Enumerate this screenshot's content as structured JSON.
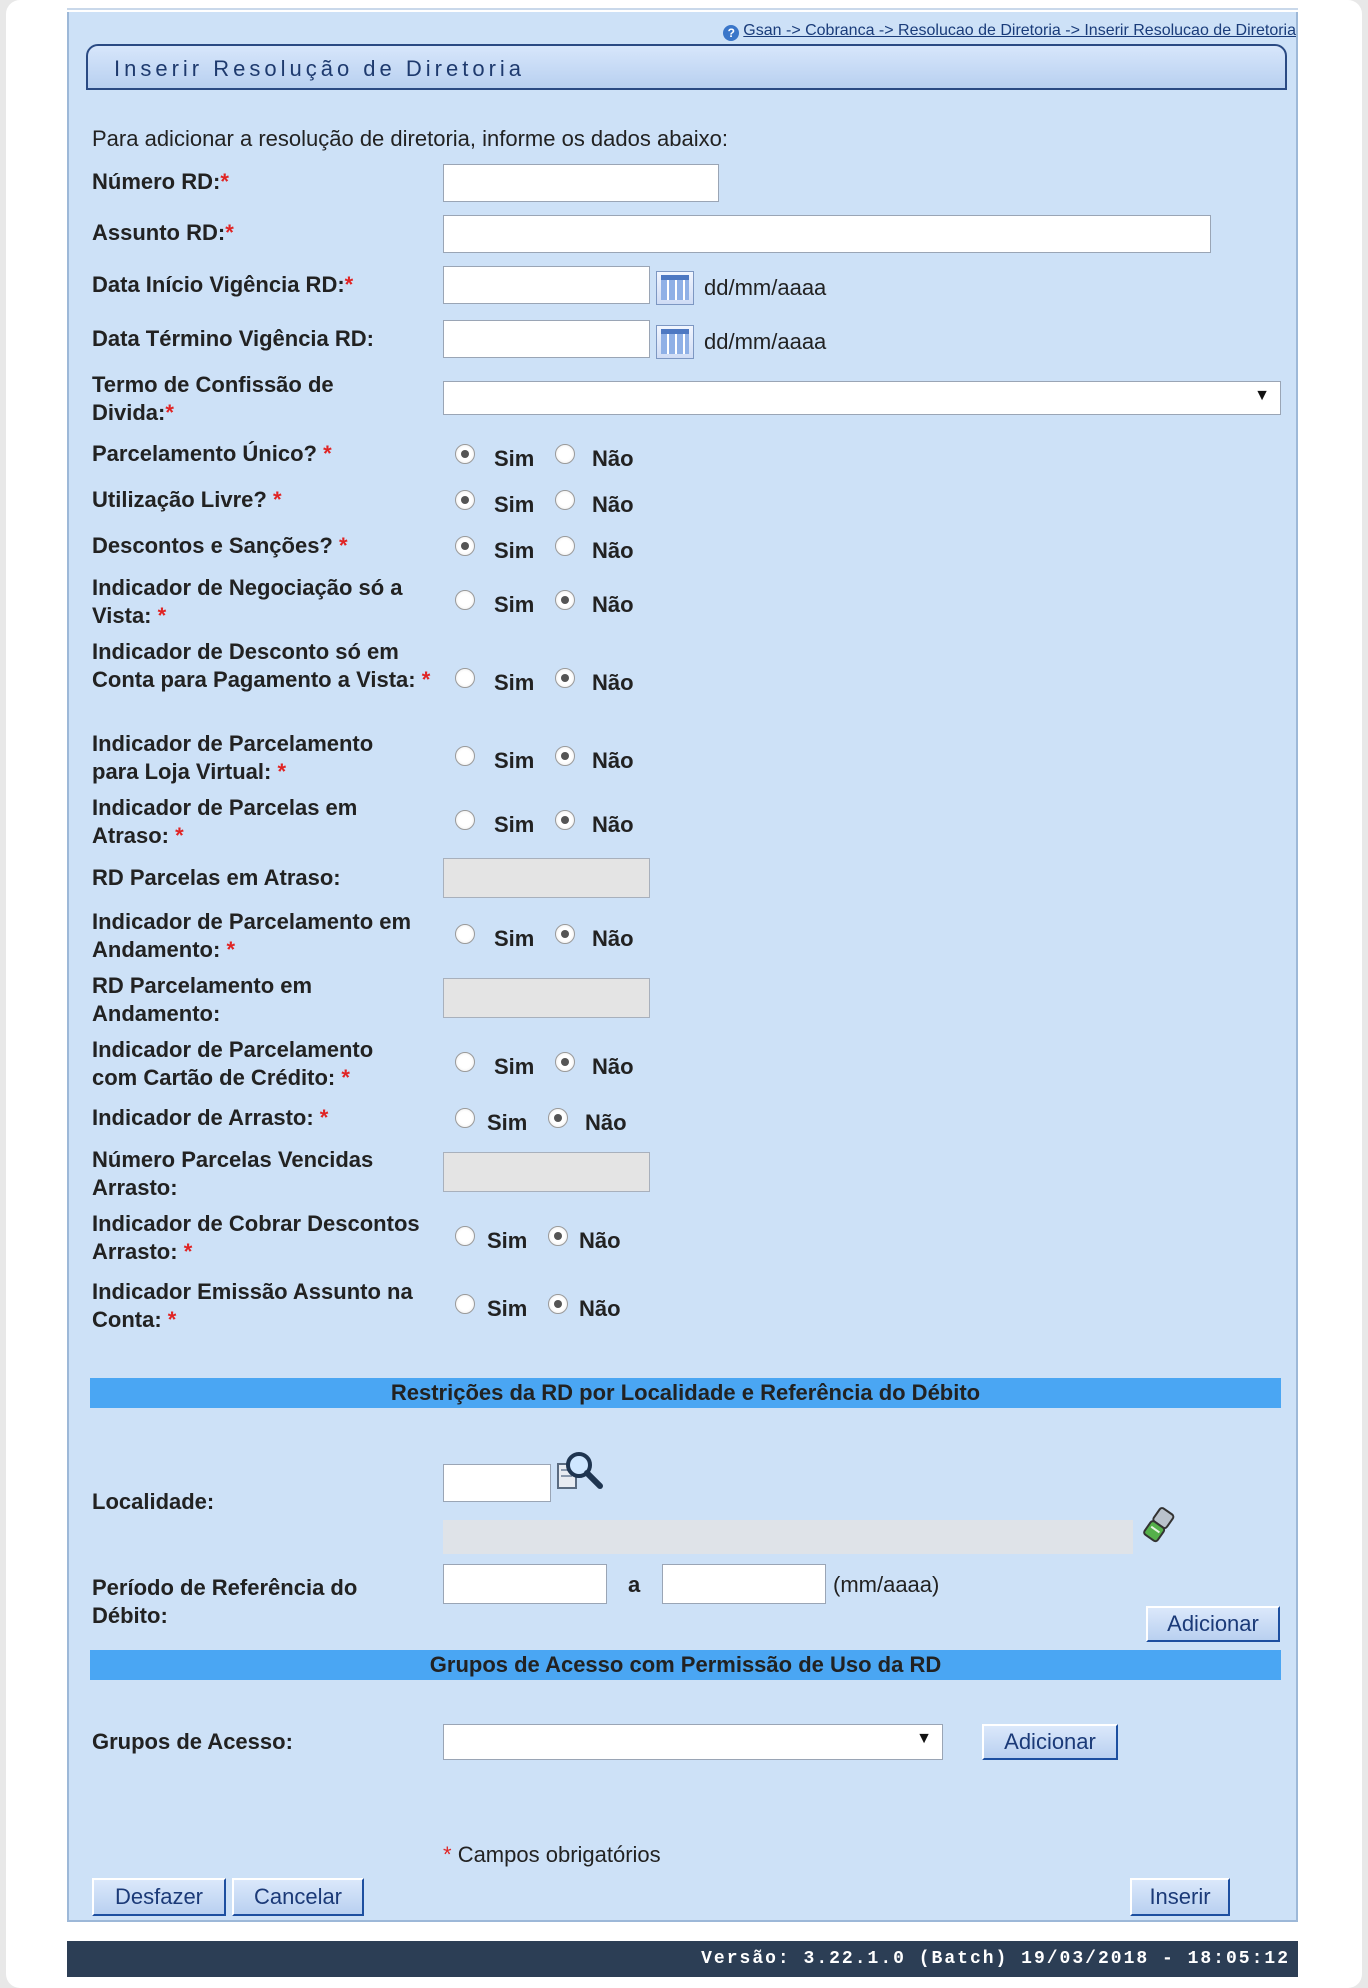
{
  "breadcrumb": "Gsan -> Cobranca -> Resolucao de Diretoria -> Inserir Resolucao de Diretoria",
  "page_title": "Inserir Resolução de Diretoria",
  "intro": "Para adicionar a resolução de diretoria, informe os dados abaixo:",
  "required_mark": "*",
  "labels": {
    "numero_rd": "Número RD:",
    "assunto_rd": "Assunto RD:",
    "data_inicio": "Data Início Vigência RD:",
    "data_termino": "Data Término Vigência RD:",
    "termo_confissao": "Termo de Confissão de Divida:",
    "parcelamento_unico": "Parcelamento Único?",
    "utilizacao_livre": "Utilização Livre?",
    "descontos_sancoes": "Descontos e Sanções?",
    "neg_vista": "Indicador de Negociação só a Vista:",
    "desc_conta_vista": "Indicador de Desconto só em Conta para Pagamento a Vista:",
    "parc_loja_virtual": "Indicador de Parcelamento para Loja Virtual:",
    "parcelas_atraso": "Indicador de Parcelas em Atraso:",
    "rd_parcelas_atraso": "RD Parcelas em Atraso:",
    "parc_andamento": "Indicador de Parcelamento em Andamento:",
    "rd_parc_andamento": "RD Parcelamento em Andamento:",
    "parc_cartao": "Indicador de Parcelamento com Cartão de Crédito:",
    "arrasto": "Indicador de Arrasto:",
    "num_parcelas_vencidas": "Número Parcelas Vencidas Arrasto:",
    "cobrar_desc_arrasto": "Indicador de Cobrar Descontos Arrasto:",
    "emissao_assunto": "Indicador Emissão Assunto na Conta:",
    "localidade": "Localidade:",
    "periodo_ref": "Período de Referência do Débito:",
    "grupos_acesso": "Grupos de Acesso:"
  },
  "date_hint": "dd/mm/aaaa",
  "month_hint": "(mm/aaaa)",
  "range_sep": "a",
  "radio": {
    "sim": "Sim",
    "nao": "Não"
  },
  "radio_values": {
    "parcelamento_unico": "Sim",
    "utilizacao_livre": "Sim",
    "descontos_sancoes": "Sim",
    "neg_vista": "Não",
    "desc_conta_vista": "Não",
    "parc_loja_virtual": "Não",
    "parcelas_atraso": "Não",
    "parc_andamento": "Não",
    "parc_cartao": "Não",
    "arrasto": "Não",
    "cobrar_desc_arrasto": "Não",
    "emissao_assunto": "Não"
  },
  "sections": {
    "restricoes": "Restrições da RD por Localidade e Referência do Débito",
    "grupos": "Grupos de Acesso com Permissão de Uso da RD"
  },
  "buttons": {
    "adicionar": "Adicionar",
    "desfazer": "Desfazer",
    "cancelar": "Cancelar",
    "inserir": "Inserir"
  },
  "required_note": "Campos obrigatórios",
  "version": "Versão: 3.22.1.0 (Batch) 19/03/2018 - 18:05:12"
}
